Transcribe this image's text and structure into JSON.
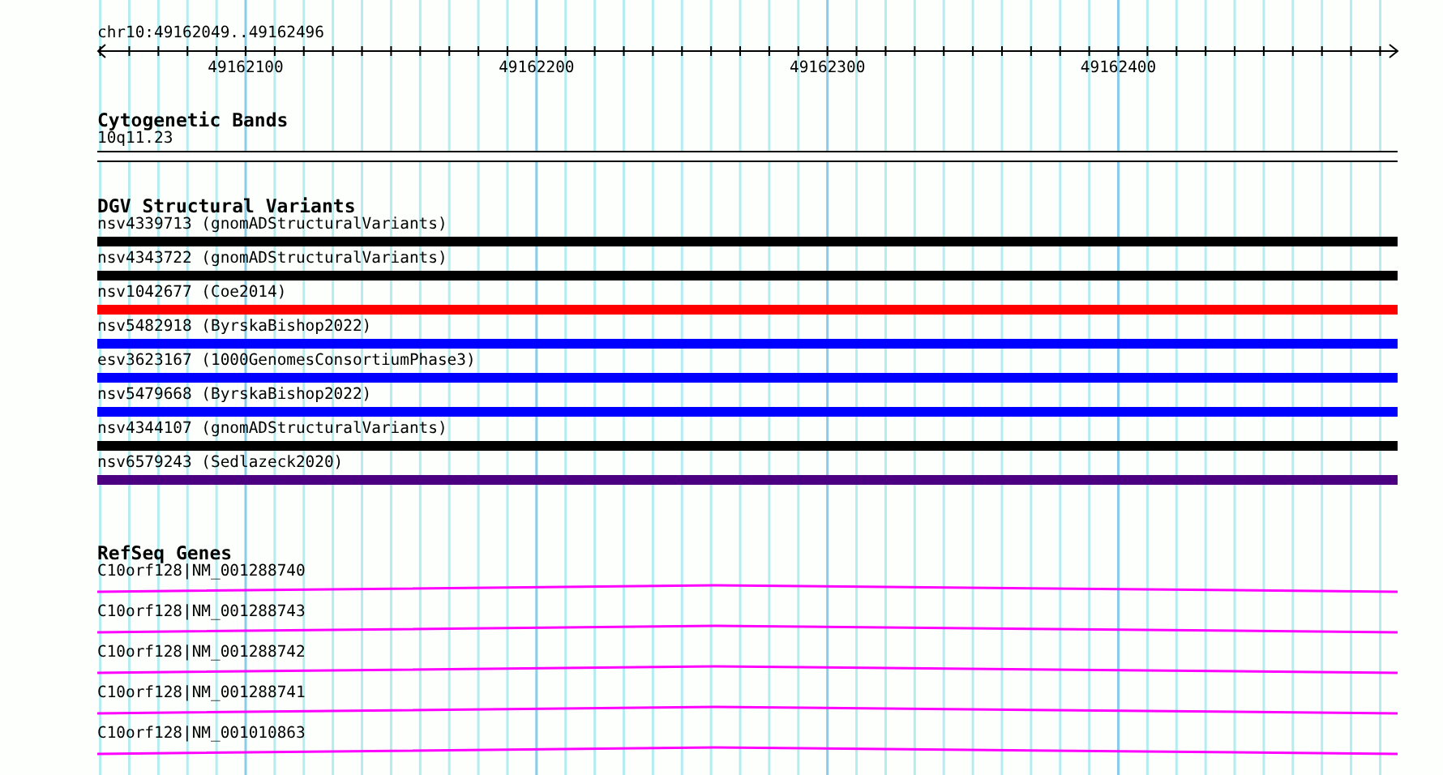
{
  "location": "chr10:49162049..49162496",
  "ruler": {
    "ticks": [
      "49162100",
      "49162200",
      "49162300",
      "49162400"
    ]
  },
  "tracks": [
    {
      "kind": "cytoband",
      "title": "Cytogenetic Bands",
      "features": [
        {
          "label": "10q11.23"
        }
      ]
    },
    {
      "kind": "variants",
      "title": "DGV Structural Variants",
      "features": [
        {
          "label": "nsv4339713 (gnomADStructuralVariants)",
          "color": "#000000"
        },
        {
          "label": "nsv4343722 (gnomADStructuralVariants)",
          "color": "#000000"
        },
        {
          "label": "nsv1042677 (Coe2014)",
          "color": "#ff0000"
        },
        {
          "label": "nsv5482918 (ByrskaBishop2022)",
          "color": "#0000ff"
        },
        {
          "label": "esv3623167 (1000GenomesConsortiumPhase3)",
          "color": "#0000ff"
        },
        {
          "label": "nsv5479668 (ByrskaBishop2022)",
          "color": "#0000ff"
        },
        {
          "label": "nsv4344107 (gnomADStructuralVariants)",
          "color": "#000000"
        },
        {
          "label": "nsv6579243 (Sedlazeck2020)",
          "color": "#4b0082"
        }
      ]
    },
    {
      "kind": "genes",
      "title": "RefSeq Genes",
      "features": [
        {
          "label": "C10orf128|NM_001288740"
        },
        {
          "label": "C10orf128|NM_001288743"
        },
        {
          "label": "C10orf128|NM_001288742"
        },
        {
          "label": "C10orf128|NM_001288741"
        },
        {
          "label": "C10orf128|NM_001010863"
        }
      ]
    }
  ]
}
